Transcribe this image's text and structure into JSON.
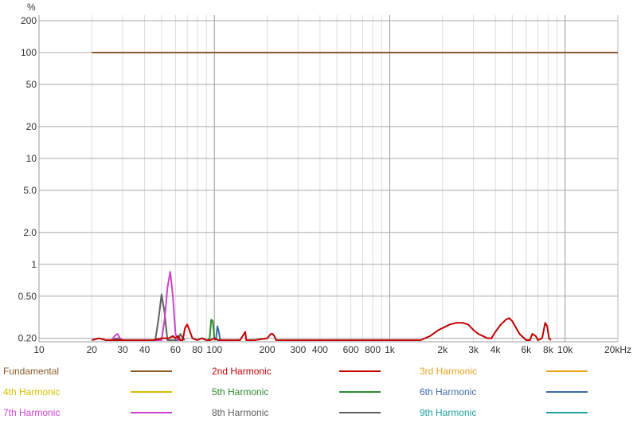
{
  "chart_data": {
    "type": "line",
    "title": "",
    "xlabel": "",
    "ylabel": "",
    "y_unit": "%",
    "x_scale": "log",
    "y_scale": "log",
    "xlim": [
      10,
      20000
    ],
    "ylim": [
      0.17,
      250
    ],
    "grid": true,
    "legend_position": "bottom",
    "x_ticks": [
      {
        "v": 10,
        "label": "10"
      },
      {
        "v": 20,
        "label": "20"
      },
      {
        "v": 30,
        "label": "30"
      },
      {
        "v": 40,
        "label": "40"
      },
      {
        "v": 60,
        "label": "60"
      },
      {
        "v": 80,
        "label": "80"
      },
      {
        "v": 100,
        "label": "100"
      },
      {
        "v": 200,
        "label": "200"
      },
      {
        "v": 300,
        "label": "300"
      },
      {
        "v": 400,
        "label": "400"
      },
      {
        "v": 600,
        "label": "600"
      },
      {
        "v": 800,
        "label": "800"
      },
      {
        "v": 1000,
        "label": "1k"
      },
      {
        "v": 2000,
        "label": "2k"
      },
      {
        "v": 3000,
        "label": "3k"
      },
      {
        "v": 4000,
        "label": "4k"
      },
      {
        "v": 6000,
        "label": "6k"
      },
      {
        "v": 8000,
        "label": "8k"
      },
      {
        "v": 10000,
        "label": "10k"
      },
      {
        "v": 20000,
        "label": "20kHz"
      }
    ],
    "y_ticks": [
      {
        "v": 200,
        "label": "200"
      },
      {
        "v": 100,
        "label": "100"
      },
      {
        "v": 50,
        "label": "50"
      },
      {
        "v": 20,
        "label": "20"
      },
      {
        "v": 10,
        "label": "10"
      },
      {
        "v": 5,
        "label": "5.0"
      },
      {
        "v": 2,
        "label": "2.0"
      },
      {
        "v": 1,
        "label": "1"
      },
      {
        "v": 0.5,
        "label": "0.50"
      },
      {
        "v": 0.2,
        "label": "0.20"
      }
    ],
    "series": [
      {
        "name": "Fundamental",
        "color": "#8b5a2b",
        "x": [
          20,
          20000
        ],
        "values": [
          100,
          100
        ]
      },
      {
        "name": "2nd Harmonic",
        "color": "#c00000",
        "x": [
          20,
          22,
          24,
          26,
          30,
          35,
          40,
          45,
          50,
          55,
          58,
          60,
          62,
          64,
          66,
          68,
          70,
          72,
          75,
          80,
          85,
          90,
          95,
          100,
          105,
          110,
          115,
          120,
          140,
          150,
          152,
          155,
          170,
          200,
          210,
          215,
          220,
          225,
          230,
          235,
          240,
          800,
          1000,
          1200,
          1500,
          1700,
          1900,
          2000,
          2200,
          2400,
          2600,
          2800,
          3000,
          3200,
          3400,
          3600,
          3800,
          4000,
          4300,
          4600,
          4800,
          5000,
          5500,
          6000,
          6300,
          6500,
          6800,
          7000,
          7400,
          7700,
          7900,
          8100,
          8300
        ],
        "values": [
          0.19,
          0.2,
          0.18,
          0.17,
          0.18,
          0.19,
          0.19,
          0.19,
          0.2,
          0.2,
          0.21,
          0.2,
          0.21,
          0.18,
          0.19,
          0.25,
          0.27,
          0.24,
          0.2,
          0.19,
          0.2,
          0.19,
          0.19,
          0.2,
          0.19,
          0.18,
          0.18,
          0.19,
          0.18,
          0.23,
          0.18,
          0.17,
          0.18,
          0.2,
          0.22,
          0.22,
          0.21,
          0.19,
          0.18,
          0.18,
          0.17,
          0.17,
          0.17,
          0.17,
          0.18,
          0.21,
          0.24,
          0.25,
          0.27,
          0.28,
          0.28,
          0.27,
          0.24,
          0.22,
          0.21,
          0.2,
          0.2,
          0.23,
          0.27,
          0.3,
          0.31,
          0.29,
          0.22,
          0.18,
          0.18,
          0.22,
          0.21,
          0.17,
          0.2,
          0.28,
          0.26,
          0.2,
          0.17
        ]
      },
      {
        "name": "3rd Harmonic",
        "color": "#e8a020",
        "x": [],
        "values": []
      },
      {
        "name": "4th Harmonic",
        "color": "#d4c000",
        "x": [],
        "values": []
      },
      {
        "name": "5th Harmonic",
        "color": "#2e8b2e",
        "x": [
          92,
          94,
          96,
          98,
          100,
          102
        ],
        "values": [
          0.17,
          0.2,
          0.3,
          0.29,
          0.2,
          0.17
        ]
      },
      {
        "name": "6th Harmonic",
        "color": "#3c6aa8",
        "x": [
          102,
          104,
          106,
          108
        ],
        "values": [
          0.17,
          0.26,
          0.23,
          0.17
        ]
      },
      {
        "name": "7th Harmonic",
        "color": "#cc44cc",
        "x": [
          26,
          27,
          28,
          29,
          30,
          31,
          50,
          52,
          54,
          56,
          58,
          60,
          62,
          64
        ],
        "values": [
          0.17,
          0.21,
          0.22,
          0.2,
          0.17,
          0.17,
          0.17,
          0.3,
          0.6,
          0.85,
          0.5,
          0.22,
          0.17,
          0.17
        ]
      },
      {
        "name": "8th Harmonic",
        "color": "#606060",
        "x": [
          26,
          28,
          30,
          46,
          48,
          50,
          52,
          54,
          56,
          62,
          64,
          66,
          68
        ],
        "values": [
          0.17,
          0.2,
          0.17,
          0.17,
          0.3,
          0.52,
          0.35,
          0.18,
          0.17,
          0.17,
          0.22,
          0.2,
          0.17
        ]
      },
      {
        "name": "9th Harmonic",
        "color": "#20a0a0",
        "x": [],
        "values": []
      }
    ]
  }
}
